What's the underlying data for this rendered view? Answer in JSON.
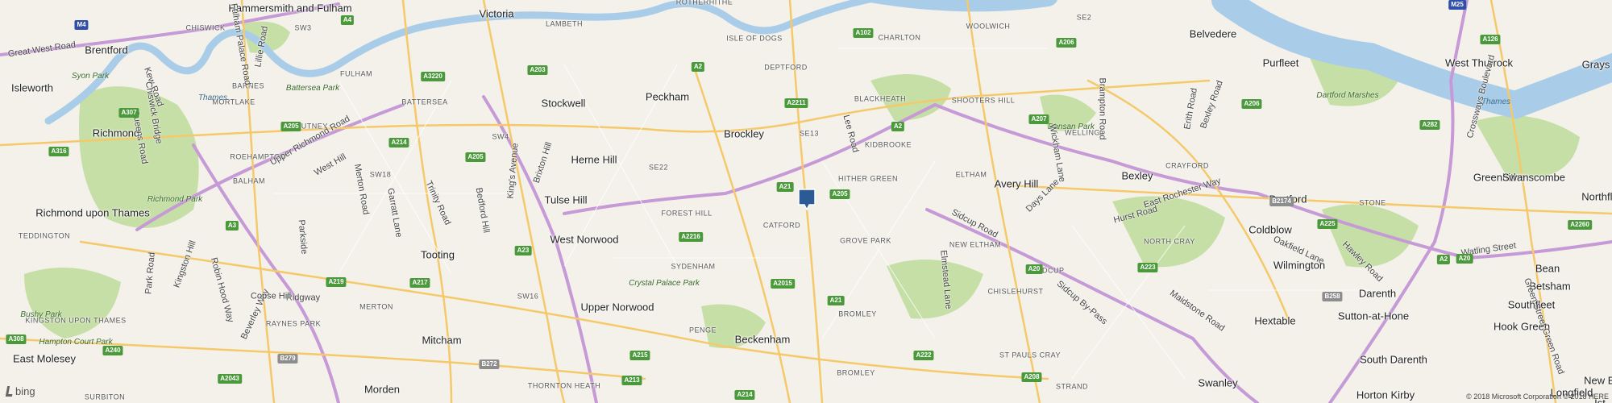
{
  "map": {
    "provider": "bing",
    "copyright": "© 2018 Microsoft Corporation © 2018 HERE",
    "pin_color": "#2c5a94",
    "colors": {
      "land": "#f3f1ea",
      "park": "#c6dfa6",
      "water": "#a9cde8",
      "road_major": "#f5c96a",
      "road_motorway": "#c59ad6"
    },
    "towns": [
      "Hammersmith and Fulham",
      "Victoria",
      "Brentford",
      "Isleworth",
      "Stockwell",
      "Peckham",
      "Brockley",
      "Richmond",
      "Herne Hill",
      "Richmond upon Thames",
      "Tulse Hill",
      "West Norwood",
      "Tooting",
      "Upper Norwood",
      "Mitcham",
      "Beckenham",
      "Morden",
      "East Molesey",
      "Belvedere",
      "Avery Hill",
      "Bexley",
      "Dartford",
      "Coldblow",
      "Wilmington",
      "Hextable",
      "Swanley",
      "Purfleet",
      "West Thurrock",
      "Grays",
      "Greenhithe",
      "Swanscombe",
      "Northfle",
      "Bean",
      "Betsham",
      "Darenth",
      "Southfleet",
      "Sutton-at-Hone",
      "Hook Green",
      "South Darenth",
      "Horton Kirby",
      "New Bar",
      "Longfield",
      "Ist"
    ],
    "areas": [
      "CHISWICK",
      "ROTHERHITHE",
      "LAMBETH",
      "ISLE OF DOGS",
      "WOOLWICH",
      "CHARLTON",
      "SE2",
      "SW3",
      "FULHAM",
      "BARNES",
      "MORTLAKE",
      "BATTERSEA",
      "DEPTFORD",
      "BLACKHEATH",
      "SHOOTERS HILL",
      "PUTNEY",
      "SW4",
      "SE13",
      "KIDBROOKE",
      "WELLING",
      "ROEHAMPTON",
      "SE22",
      "HITHER GREEN",
      "ELTHAM",
      "CRAYFORD",
      "BALHAM",
      "SW18",
      "FOREST HILL",
      "CATFORD",
      "GROVE PARK",
      "NEW ELTHAM",
      "NORTH CRAY",
      "STONE",
      "TEDDINGTON",
      "SYDENHAM",
      "SIDCUP",
      "SW16",
      "MERTON",
      "PENGE",
      "CHISLEHURST",
      "KINGSTON UPON THAMES",
      "RAYNES PARK",
      "BROMLEY",
      "ST PAULS CRAY",
      "SURBITON",
      "THORNTON HEATH",
      "BROMLEY",
      "STRAND"
    ],
    "parks": [
      "Syon Park",
      "Battersea Park",
      "Richmond Park",
      "Bushy Park",
      "Hampton Court Park",
      "Crystal Palace Park",
      "Dartford Marshes",
      "Dansan Park"
    ],
    "waters": [
      "Thames",
      "Thames"
    ],
    "roads": [
      "Great West Road",
      "Lillie Road",
      "Fulham Palace Road",
      "Kew Road",
      "Chiswick Bridge",
      "Upper Richmond Road",
      "West Hill",
      "Brixton Hill",
      "King's Avenue",
      "Trinity Road",
      "Queens Road",
      "Garratt Lane",
      "Bedford Hill",
      "Merton Road",
      "Kingston Hill",
      "Robin Hood Way",
      "Beverley Way",
      "Park Road",
      "Ridgway",
      "Copse Hill",
      "Parkside",
      "Lee Road",
      "Sidcup Road",
      "Days Lane",
      "Wickham Lane",
      "Brampton Road",
      "Erith Road",
      "Bexley Road",
      "East Rochester Way",
      "Hurst Road",
      "Oakfield Lane",
      "Hawley Road",
      "Watling Street",
      "Maidstone Road",
      "Sidcup By-Pass",
      "Elmstead Lane",
      "Crossways Boulevard",
      "Green Street Green Road"
    ],
    "shields": [
      "M4",
      "A4",
      "A3220",
      "A205",
      "A214",
      "A205",
      "A3",
      "A219",
      "A217",
      "A23",
      "A203",
      "A2",
      "A2211",
      "A102",
      "A206",
      "A207",
      "A206",
      "A21",
      "A205",
      "A2216",
      "A2015",
      "A21",
      "A222",
      "A20",
      "A223",
      "A208",
      "A215",
      "A213",
      "A214",
      "B279",
      "B272",
      "A308",
      "A240",
      "A2043",
      "A316",
      "A307",
      "A2",
      "B2174",
      "A225",
      "A20",
      "A2",
      "A282",
      "A126",
      "M25",
      "A2260",
      "B258"
    ]
  }
}
